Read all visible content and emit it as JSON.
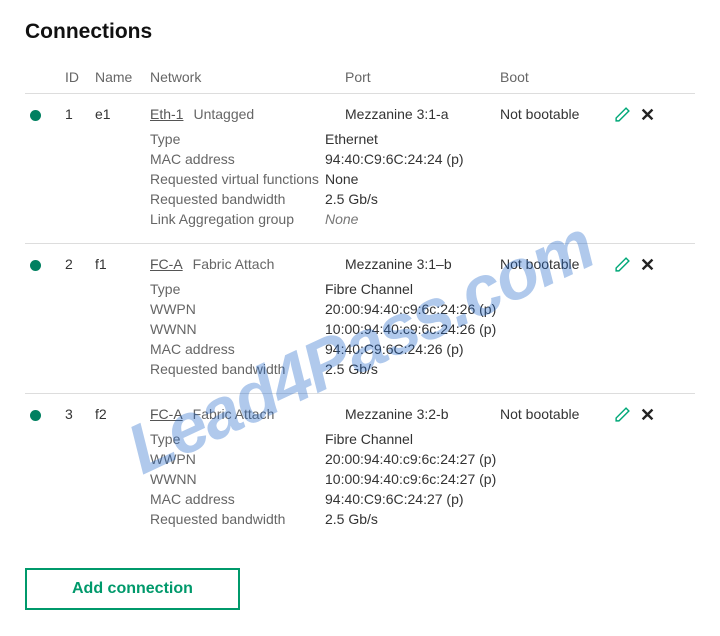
{
  "title": "Connections",
  "headers": {
    "id": "ID",
    "name": "Name",
    "network": "Network",
    "port": "Port",
    "boot": "Boot"
  },
  "watermark": "Lead4Pass.com",
  "add_button": "Add connection",
  "connections": [
    {
      "id": "1",
      "name": "e1",
      "network": "Eth-1",
      "network_mode": "Untagged",
      "port": "Mezzanine 3:1-a",
      "boot": "Not bootable",
      "details": [
        {
          "label": "Type",
          "value": "Ethernet"
        },
        {
          "label": "MAC address",
          "value": "94:40:C9:6C:24:24 (p)"
        },
        {
          "label": "Requested virtual functions",
          "value": "None"
        },
        {
          "label": "Requested bandwidth",
          "value": "2.5 Gb/s"
        },
        {
          "label": "Link Aggregation group",
          "value": "None",
          "italic": true
        }
      ]
    },
    {
      "id": "2",
      "name": "f1",
      "network": "FC-A",
      "network_mode": "Fabric Attach",
      "port": "Mezzanine 3:1–b",
      "boot": "Not bootable",
      "details": [
        {
          "label": "Type",
          "value": "Fibre Channel"
        },
        {
          "label": "WWPN",
          "value": "20:00:94:40:c9:6c:24:26 (p)"
        },
        {
          "label": "WWNN",
          "value": "10:00:94:40:c9:6c:24:26 (p)"
        },
        {
          "label": "MAC address",
          "value": "94:40:C9:6C:24:26 (p)"
        },
        {
          "label": "Requested bandwidth",
          "value": "2.5 Gb/s"
        }
      ]
    },
    {
      "id": "3",
      "name": "f2",
      "network": "FC-A",
      "network_mode": "Fabric Attach",
      "port": "Mezzanine 3:2-b",
      "boot": "Not bootable",
      "details": [
        {
          "label": "Type",
          "value": "Fibre Channel"
        },
        {
          "label": "WWPN",
          "value": "20:00:94:40:c9:6c:24:27 (p)"
        },
        {
          "label": "WWNN",
          "value": "10:00:94:40:c9:6c:24:27 (p)"
        },
        {
          "label": "MAC address",
          "value": "94:40:C9:6C:24:27 (p)"
        },
        {
          "label": "Requested bandwidth",
          "value": "2.5 Gb/s"
        }
      ]
    }
  ]
}
